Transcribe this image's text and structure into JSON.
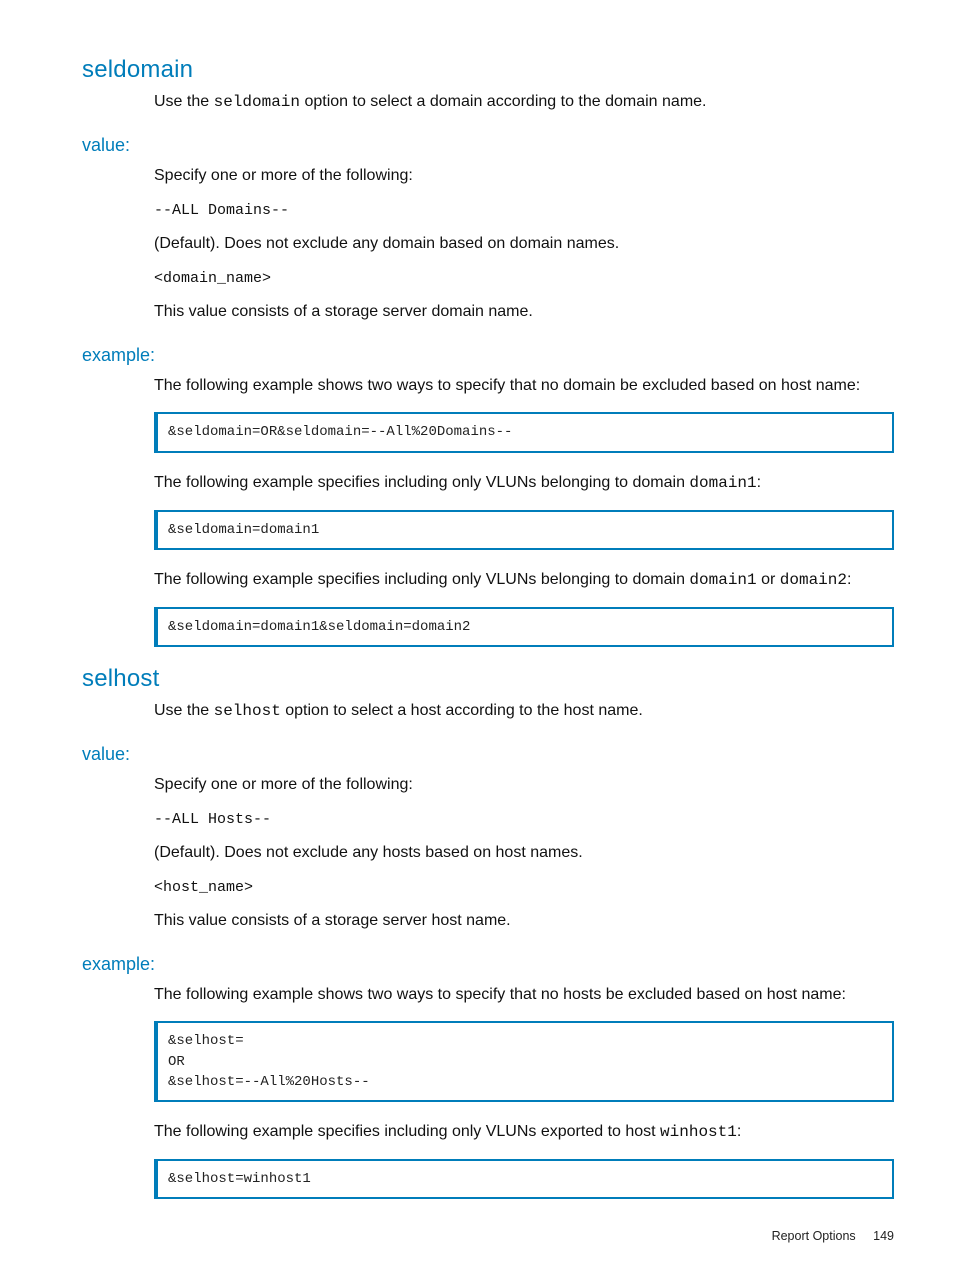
{
  "sections": [
    {
      "title": "seldomain",
      "intro_pre": "Use the ",
      "intro_code": "seldomain",
      "intro_post": " option to select a domain according to the domain name.",
      "value_label": "value:",
      "value_lines": {
        "lead": "Specify one or more of the following:",
        "all_token": "--ALL Domains--",
        "all_desc": "(Default). Does not exclude any domain based on domain names.",
        "name_token": "<domain_name>",
        "name_desc": "This value consists of a storage server domain name."
      },
      "example_label": "example:",
      "examples": [
        {
          "desc": "The following example shows two ways to specify that no domain be excluded based on host name:",
          "code": "&seldomain=OR&seldomain=--All%20Domains--"
        },
        {
          "desc_pre": "The following example specifies including only VLUNs belonging to domain ",
          "desc_code": "domain1",
          "desc_post": ":",
          "code": "&seldomain=domain1"
        },
        {
          "desc_pre": "The following example specifies including only VLUNs belonging to domain ",
          "desc_code": "domain1",
          "desc_mid": " or ",
          "desc_code2": "domain2",
          "desc_post": ":",
          "code": "&seldomain=domain1&seldomain=domain2"
        }
      ]
    },
    {
      "title": "selhost",
      "intro_pre": "Use the ",
      "intro_code": "selhost",
      "intro_post": " option to select a host according to the host name.",
      "value_label": "value:",
      "value_lines": {
        "lead": "Specify one or more of the following:",
        "all_token": "--ALL Hosts--",
        "all_desc": "(Default). Does not exclude any hosts based on host names.",
        "name_token": "<host_name>",
        "name_desc": "This value consists of a storage server host name."
      },
      "example_label": "example:",
      "examples": [
        {
          "desc": "The following example shows two ways to specify that no hosts be excluded based on host name:",
          "code": "&selhost=\nOR\n&selhost=--All%20Hosts--"
        },
        {
          "desc_pre": "The following example specifies including only VLUNs exported to host ",
          "desc_code": "winhost1",
          "desc_post": ":",
          "code": "&selhost=winhost1"
        }
      ]
    }
  ],
  "footer": {
    "label": "Report Options",
    "page": "149"
  }
}
